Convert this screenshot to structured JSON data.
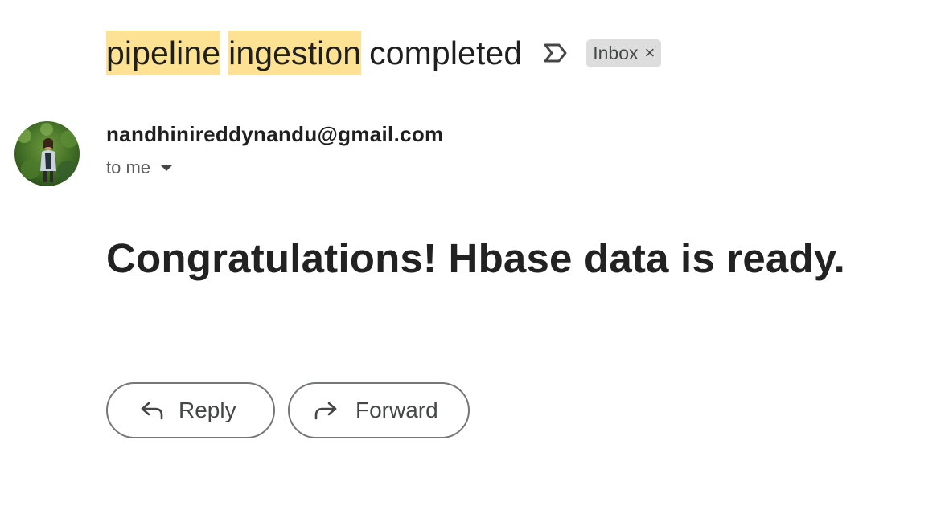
{
  "subject": {
    "highlight_1": "pipeline",
    "highlight_2": "ingestion",
    "rest": "completed"
  },
  "important_marker": {
    "icon": "important-marker-icon"
  },
  "label_chip": {
    "label": "Inbox",
    "close_glyph": "×"
  },
  "sender": {
    "email": "nandhinireddynandu@gmail.com",
    "recipient": "to me",
    "avatar_icon": "sender-avatar-photo"
  },
  "message": {
    "body": "Congratulations! Hbase data is ready."
  },
  "actions": {
    "reply_label": "Reply",
    "forward_label": "Forward"
  },
  "colors": {
    "highlight": "#fde293",
    "chip_bg": "#dddddd",
    "text": "#1f1f1f",
    "button_border": "#747775"
  }
}
